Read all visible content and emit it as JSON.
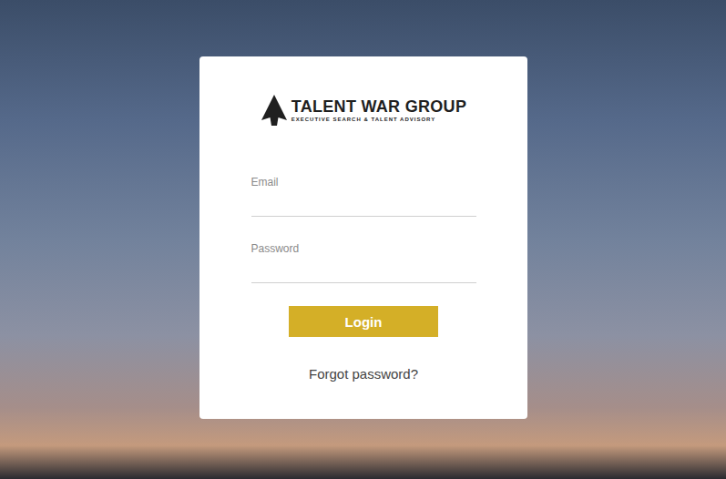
{
  "logo": {
    "name": "TALENT WAR GROUP",
    "tagline": "EXECUTIVE SEARCH & TALENT ADVISORY"
  },
  "fields": [
    {
      "label": "Email"
    },
    {
      "label": "Password"
    }
  ],
  "button": "Login",
  "forgot": "Forgot password?"
}
